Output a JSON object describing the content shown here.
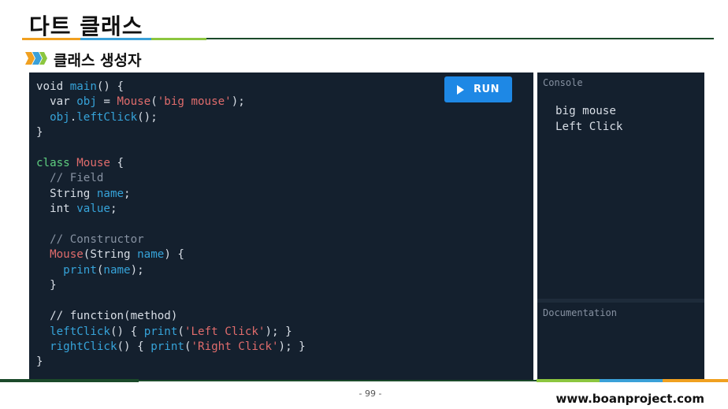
{
  "slide": {
    "title": "다트 클래스",
    "subtitle": "클래스 생성자",
    "page_number": "- 99 -",
    "website": "www.boanproject.com"
  },
  "editor": {
    "run_label": "RUN",
    "lines": [
      [
        [
          "kw",
          "void "
        ],
        [
          "fn",
          "main"
        ],
        [
          "kw",
          "() {"
        ]
      ],
      [
        [
          "kw",
          "  var "
        ],
        [
          "var",
          "obj"
        ],
        [
          "kw",
          " = "
        ],
        [
          "cls",
          "Mouse"
        ],
        [
          "kw",
          "("
        ],
        [
          "str",
          "'big mouse'"
        ],
        [
          "kw",
          ");"
        ]
      ],
      [
        [
          "var",
          "  obj"
        ],
        [
          "kw",
          "."
        ],
        [
          "fn",
          "leftClick"
        ],
        [
          "kw",
          "();"
        ]
      ],
      [
        [
          "kw",
          "}"
        ]
      ],
      [
        [
          "kw",
          ""
        ]
      ],
      [
        [
          "kwg",
          "class "
        ],
        [
          "cls",
          "Mouse"
        ],
        [
          "kw",
          " {"
        ]
      ],
      [
        [
          "cm",
          "  // Field"
        ]
      ],
      [
        [
          "kw",
          "  String "
        ],
        [
          "var",
          "name"
        ],
        [
          "kw",
          ";"
        ]
      ],
      [
        [
          "kw",
          "  int "
        ],
        [
          "var",
          "value"
        ],
        [
          "kw",
          ";"
        ]
      ],
      [
        [
          "kw",
          ""
        ]
      ],
      [
        [
          "cm",
          "  // Constructor"
        ]
      ],
      [
        [
          "cls",
          "  Mouse"
        ],
        [
          "kw",
          "(String "
        ],
        [
          "var",
          "name"
        ],
        [
          "kw",
          ") {"
        ]
      ],
      [
        [
          "fn",
          "    print"
        ],
        [
          "kw",
          "("
        ],
        [
          "var",
          "name"
        ],
        [
          "kw",
          ");"
        ]
      ],
      [
        [
          "kw",
          "  }"
        ]
      ],
      [
        [
          "kw",
          ""
        ]
      ],
      [
        [
          "kw",
          "  // function(method)"
        ]
      ],
      [
        [
          "fn",
          "  leftClick"
        ],
        [
          "kw",
          "() { "
        ],
        [
          "fn",
          "print"
        ],
        [
          "kw",
          "("
        ],
        [
          "str",
          "'Left Click'"
        ],
        [
          "kw",
          "); }"
        ]
      ],
      [
        [
          "fn",
          "  rightClick"
        ],
        [
          "kw",
          "() { "
        ],
        [
          "fn",
          "print"
        ],
        [
          "kw",
          "("
        ],
        [
          "str",
          "'Right Click'"
        ],
        [
          "kw",
          "); }"
        ]
      ],
      [
        [
          "kw",
          "}"
        ]
      ]
    ]
  },
  "console": {
    "label": "Console",
    "output": "big mouse\nLeft Click"
  },
  "docs": {
    "label": "Documentation"
  },
  "colors": {
    "panel_bg": "#14202e",
    "run_button": "#1e88e5",
    "function": "#36a3d9",
    "class_string": "#e06c6c",
    "keyword_class": "#5fcf80",
    "comment": "#8792a2"
  }
}
